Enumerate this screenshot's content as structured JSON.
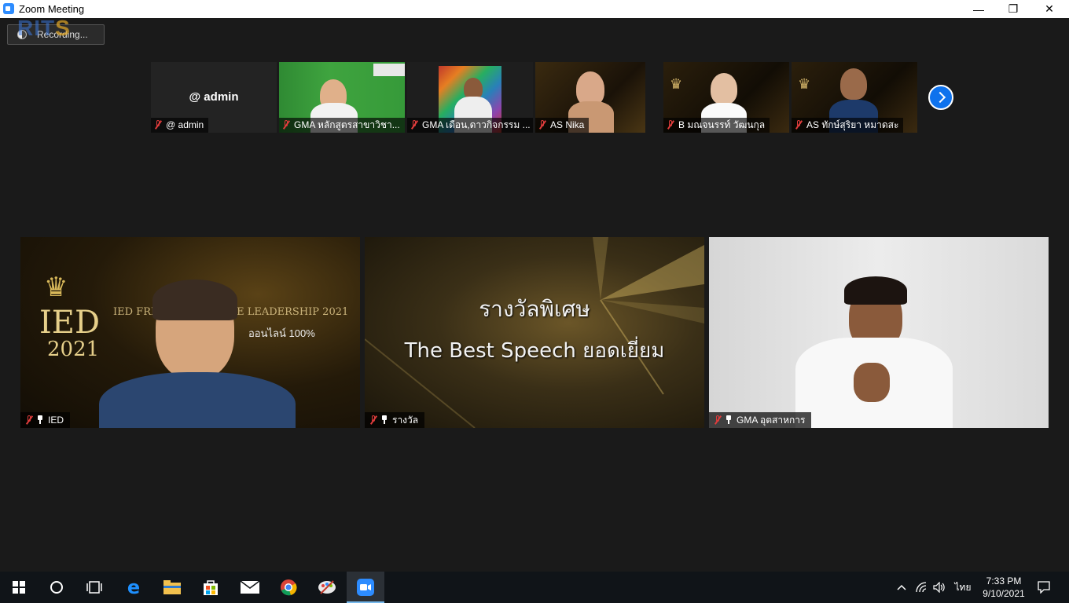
{
  "window": {
    "title": "Zoom Meeting",
    "minimize_glyph": "—",
    "restore_glyph": "❐",
    "close_glyph": "✕"
  },
  "overlay_logo": {
    "text_a": "RIT",
    "text_b": "S"
  },
  "recording": {
    "label": "Recording..."
  },
  "thumbnails": [
    {
      "name": "@ admin",
      "center_text": "@ admin"
    },
    {
      "name": "GMA หลักสูตรสาขาวิชา..."
    },
    {
      "name": "GMA เดือน,ดาวกิจกรรม ..."
    },
    {
      "name": "AS Nika"
    },
    {
      "name": "B มณจนรรท์ วัฒนกุล"
    },
    {
      "name": "AS ทักษ์สุริยา หมาดสะ"
    }
  ],
  "main_tiles": [
    {
      "name": "IED",
      "banner": "IED FRESHY TO BE THE LEADERSHIP 2021",
      "subbanner": "ออนไลน์ 100%",
      "crown_text": "IED",
      "year": "2021"
    },
    {
      "name": "รางวัล",
      "title_line1": "รางวัลพิเศษ",
      "title_line2": "The Best Speech ยอดเยี่ยม"
    },
    {
      "name": "GMA อุตสาหการ"
    }
  ],
  "taskbar": {
    "language": "ไทย",
    "time": "7:33 PM",
    "date": "9/10/2021"
  },
  "colors": {
    "accent": "#0e72ed",
    "muted_mic": "#e03c3c",
    "background": "#1a1a1a"
  }
}
